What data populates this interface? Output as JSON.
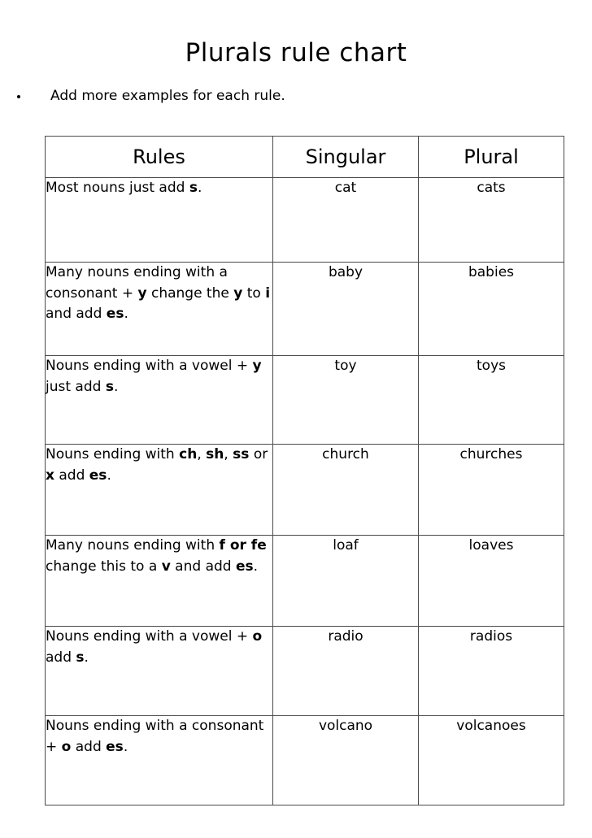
{
  "document": {
    "title": "Plurals rule chart",
    "instruction_bullet": {
      "marker": "bullet-dot",
      "text": "Add more examples for each rule."
    }
  },
  "table": {
    "columns": [
      "Rules",
      "Singular",
      "Plural"
    ],
    "rows": [
      {
        "rule_parts": [
          {
            "text": "Most nouns just add  ",
            "bold": false
          },
          {
            "text": "s",
            "bold": true
          },
          {
            "text": ".",
            "bold": false
          }
        ],
        "rule_plain": "Most nouns just add  s.",
        "singular": "cat",
        "plural": "cats"
      },
      {
        "rule_parts": [
          {
            "text": "Many nouns ending with a consonant + ",
            "bold": false
          },
          {
            "text": "y",
            "bold": true
          },
          {
            "text": " change the ",
            "bold": false
          },
          {
            "text": "y",
            "bold": true
          },
          {
            "text": " to ",
            "bold": false
          },
          {
            "text": "i",
            "bold": true
          },
          {
            "text": " and add ",
            "bold": false
          },
          {
            "text": "es",
            "bold": true
          },
          {
            "text": ".",
            "bold": false
          }
        ],
        "rule_plain": "Many nouns ending with a consonant + y change the y to i and add es.",
        "singular": "baby",
        "plural": "babies"
      },
      {
        "rule_parts": [
          {
            "text": "Nouns ending with a vowel + ",
            "bold": false
          },
          {
            "text": "y",
            "bold": true
          },
          {
            "text": " just add ",
            "bold": false
          },
          {
            "text": "s",
            "bold": true
          },
          {
            "text": ".",
            "bold": false
          }
        ],
        "rule_plain": "Nouns ending with a vowel + y just add s.",
        "singular": "toy",
        "plural": "toys"
      },
      {
        "rule_parts": [
          {
            "text": "Nouns ending with ",
            "bold": false
          },
          {
            "text": "ch",
            "bold": true
          },
          {
            "text": ", ",
            "bold": false
          },
          {
            "text": "sh",
            "bold": true
          },
          {
            "text": ", ",
            "bold": false
          },
          {
            "text": "ss",
            "bold": true
          },
          {
            "text": " or ",
            "bold": false
          },
          {
            "text": "x",
            "bold": true
          },
          {
            "text": " add ",
            "bold": false
          },
          {
            "text": "es",
            "bold": true
          },
          {
            "text": ".",
            "bold": false
          }
        ],
        "rule_plain": "Nouns ending with ch, sh, ss or x add es.",
        "singular": "church",
        "plural": "churches"
      },
      {
        "rule_parts": [
          {
            "text": "Many nouns ending with ",
            "bold": false
          },
          {
            "text": "f or fe",
            "bold": true
          },
          {
            "text": " change this to a ",
            "bold": false
          },
          {
            "text": "v",
            "bold": true
          },
          {
            "text": " and add ",
            "bold": false
          },
          {
            "text": "es",
            "bold": true
          },
          {
            "text": ".",
            "bold": false
          }
        ],
        "rule_plain": "Many nouns ending with f or fe change this to a v and add es.",
        "singular": "loaf",
        "plural": "loaves"
      },
      {
        "rule_parts": [
          {
            "text": "Nouns ending with a vowel + ",
            "bold": false
          },
          {
            "text": "o",
            "bold": true
          },
          {
            "text": " add ",
            "bold": false
          },
          {
            "text": "s",
            "bold": true
          },
          {
            "text": ".",
            "bold": false
          }
        ],
        "rule_plain": "Nouns ending with a vowel + o add s.",
        "singular": "radio",
        "plural": "radios"
      },
      {
        "rule_parts": [
          {
            "text": "Nouns ending with a  consonant + ",
            "bold": false
          },
          {
            "text": "o",
            "bold": true
          },
          {
            "text": " add ",
            "bold": false
          },
          {
            "text": "es",
            "bold": true
          },
          {
            "text": ".",
            "bold": false
          }
        ],
        "rule_plain": "Nouns ending with a  consonant + o add es.",
        "singular": "volcano",
        "plural": "volcanoes"
      }
    ]
  },
  "colors": {
    "page_background": "#ffffff",
    "text": "#000000",
    "table_border": "#4a4a4a"
  }
}
